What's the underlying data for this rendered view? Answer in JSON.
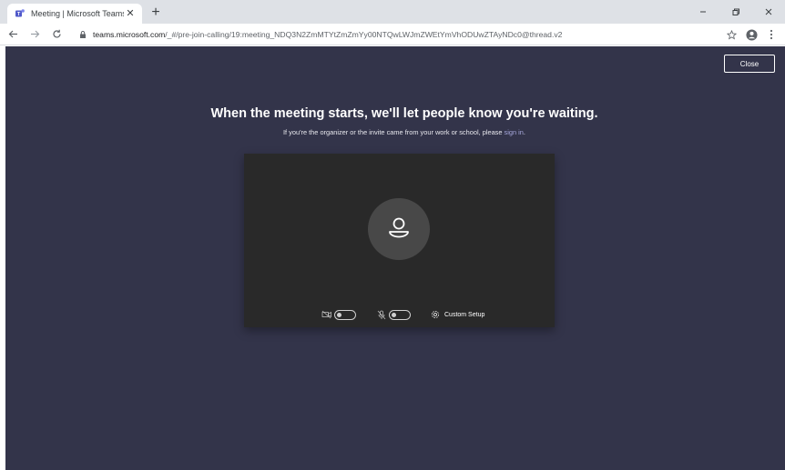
{
  "browser": {
    "tab": {
      "title": "Meeting | Microsoft Teams"
    },
    "url": {
      "host": "teams.microsoft.com",
      "path": "/_#/pre-join-calling/19:meeting_NDQ3N2ZmMTYtZmZmYy00NTQwLWJmZWEtYmVhODUwZTAyNDc0@thread.v2"
    }
  },
  "page": {
    "close_label": "Close",
    "headline": "When the meeting starts, we'll let people know you're waiting.",
    "subline_prefix": "If you're the organizer or the invite came from your work or school, please ",
    "sign_in_label": "sign in",
    "subline_suffix": ".",
    "custom_setup_label": "Custom Setup"
  },
  "colors": {
    "background": "#33344a",
    "preview": "#292929",
    "link": "#a6a7dc"
  }
}
